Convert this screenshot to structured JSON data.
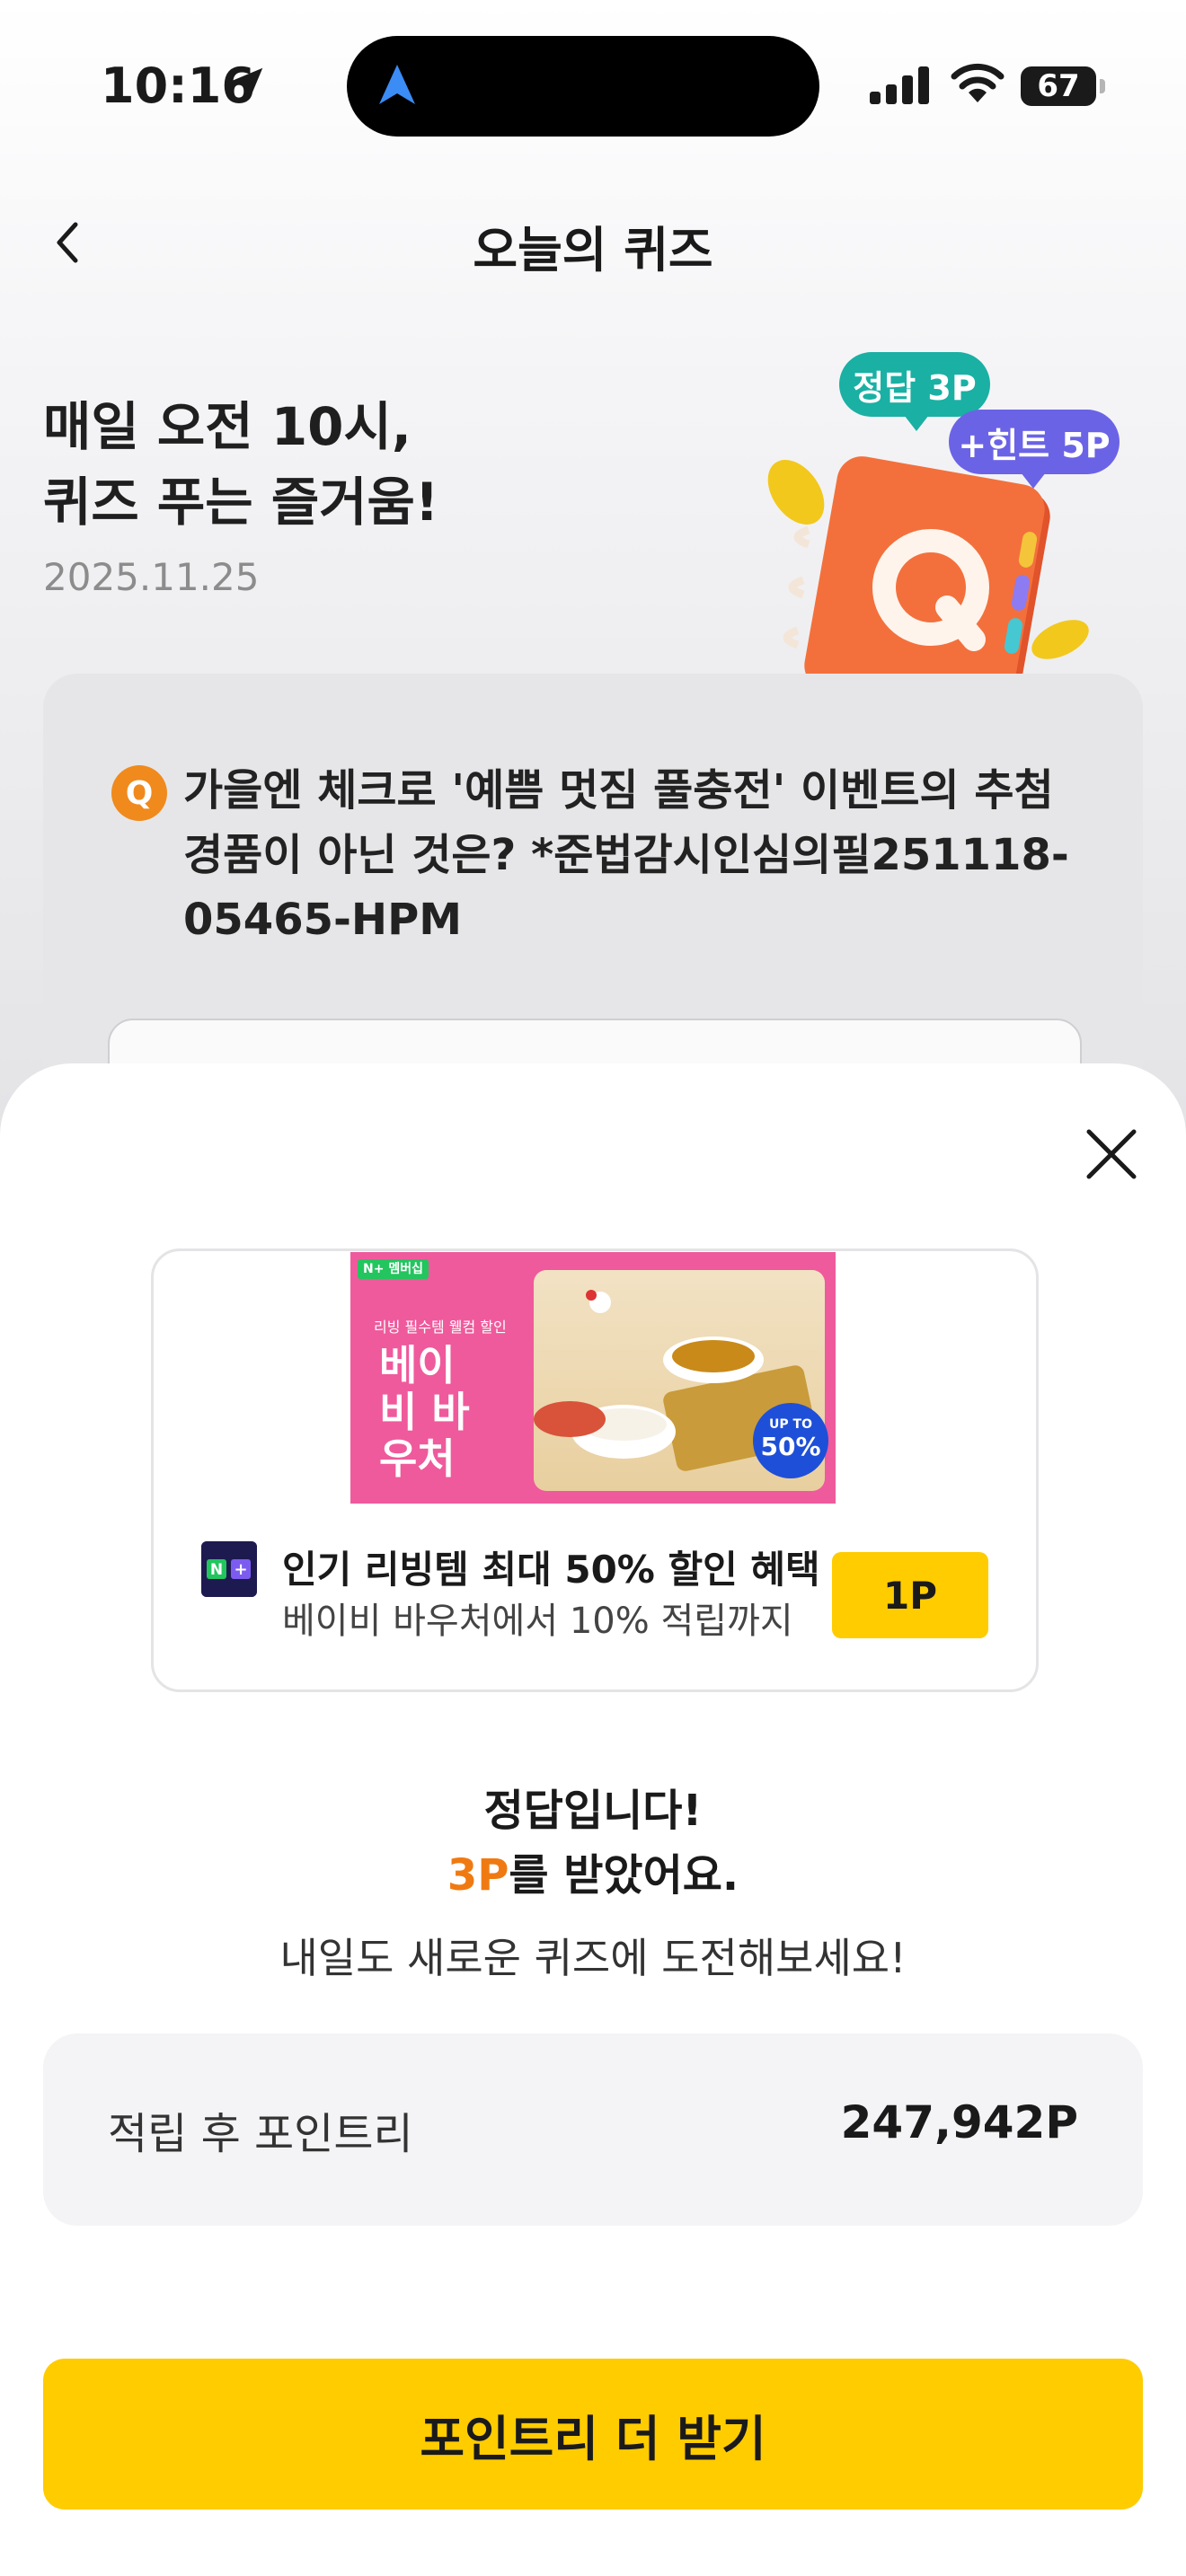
{
  "status_bar": {
    "time": "10:16",
    "battery": "67"
  },
  "header": {
    "title": "오늘의 퀴즈"
  },
  "hero": {
    "line1": "매일 오전 10시,",
    "line2": "퀴즈 푸는 즐거움!",
    "date": "2025.11.25",
    "bubble_correct": "정답 3P",
    "bubble_hint": "+힌트 5P"
  },
  "question": {
    "badge": "Q",
    "text": "가을엔 체크로 '예쁨 멋짐 풀충전' 이벤트의 추첨 경품이 아닌 것은? *준법감시인심의필251118-05465-HPM"
  },
  "ad": {
    "banner_tag": "N+ 멤버십",
    "banner_small": "리빙 필수템 웰컴 할인",
    "banner_big": "베이비 바우처",
    "banner_badge_top": "UP TO",
    "banner_badge_value": "50%",
    "title": "인기 리빙템 최대 50% 할인 혜택",
    "subtitle": "베이비 바우처에서 10% 적립까지",
    "point_button": "1P",
    "colors": {
      "banner": "#ef5a9c",
      "button": "#ffcc00"
    }
  },
  "result": {
    "line1": "정답입니다!",
    "points_accent": "3P",
    "line2_rest": "를 받았어요.",
    "sub": "내일도 새로운 퀴즈에 도전해보세요!"
  },
  "points": {
    "label": "적립 후 포인트리",
    "value": "247,942P"
  },
  "cta": {
    "label": "포인트리 더 받기"
  }
}
